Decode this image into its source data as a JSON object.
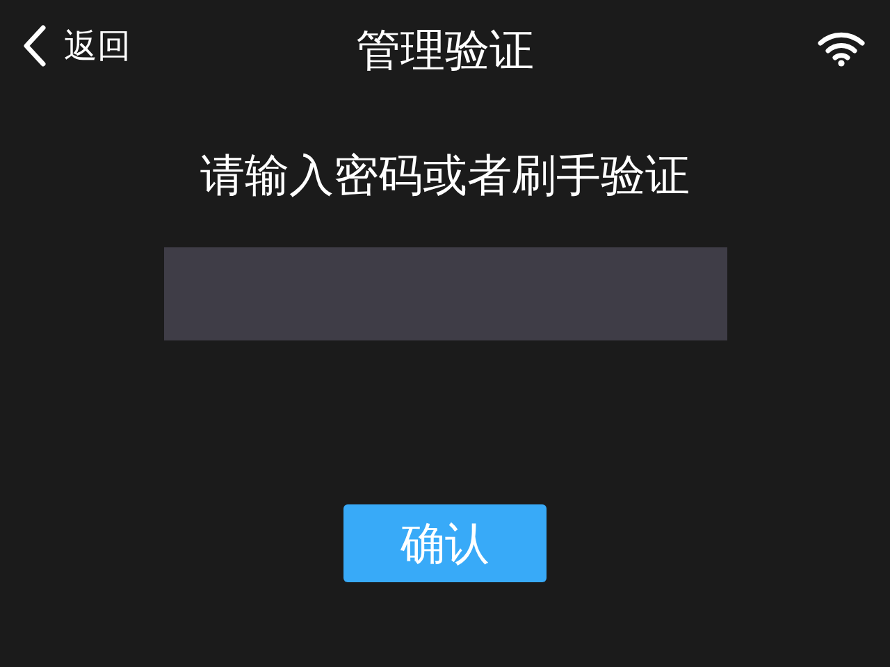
{
  "header": {
    "back_label": "返回",
    "title": "管理验证"
  },
  "prompt": "请输入密码或者刷手验证",
  "confirm_button": "确认"
}
